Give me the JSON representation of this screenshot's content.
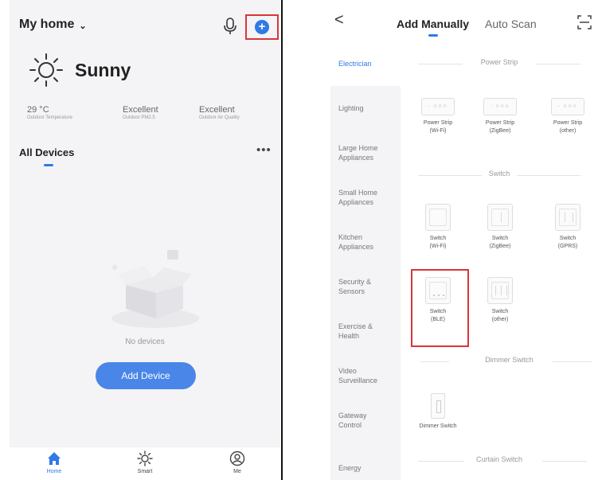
{
  "left": {
    "home_title": "My home",
    "weather": {
      "condition": "Sunny"
    },
    "stats": [
      {
        "value": "29 °C",
        "label": "Outdoor Temperature"
      },
      {
        "value": "Excellent",
        "label": "Outdoor PM2.5"
      },
      {
        "value": "Excellent",
        "label": "Outdoor Air Quality"
      }
    ],
    "devices_title": "All Devices",
    "more": "•••",
    "empty_text": "No devices",
    "add_button": "Add Device",
    "tabs": [
      {
        "label": "Home",
        "icon": "home-icon"
      },
      {
        "label": "Smart",
        "icon": "sun-icon"
      },
      {
        "label": "Me",
        "icon": "profile-icon"
      }
    ],
    "accent": "#2f7ae5",
    "highlight": "#d9363a"
  },
  "right": {
    "back": "<",
    "tab_manual": "Add Manually",
    "tab_auto": "Auto Scan",
    "categories": [
      "Electrician",
      "Lighting",
      "Large Home Appliances",
      "Small Home Appliances",
      "Kitchen Appliances",
      "Security & Sensors",
      "Exercise & Health",
      "Video Surveillance",
      "Gateway Control",
      "Energy"
    ],
    "sections": {
      "power_strip": "Power Strip",
      "switch": "Switch",
      "dimmer": "Dimmer Switch",
      "curtain": "Curtain Switch"
    },
    "power_strips": [
      {
        "line1": "Power Strip",
        "line2": "(Wi-Fi)"
      },
      {
        "line1": "Power Strip",
        "line2": "(ZigBee)"
      },
      {
        "line1": "Power Strip",
        "line2": "(other)"
      }
    ],
    "switches": [
      {
        "line1": "Switch",
        "line2": "(Wi-Fi)"
      },
      {
        "line1": "Switch",
        "line2": "(ZigBee)"
      },
      {
        "line1": "Switch",
        "line2": "(GPRS)"
      },
      {
        "line1": "Switch",
        "line2": "(BLE)"
      },
      {
        "line1": "Switch",
        "line2": "(other)"
      }
    ],
    "dimmer_item": "Dimmer Switch"
  }
}
